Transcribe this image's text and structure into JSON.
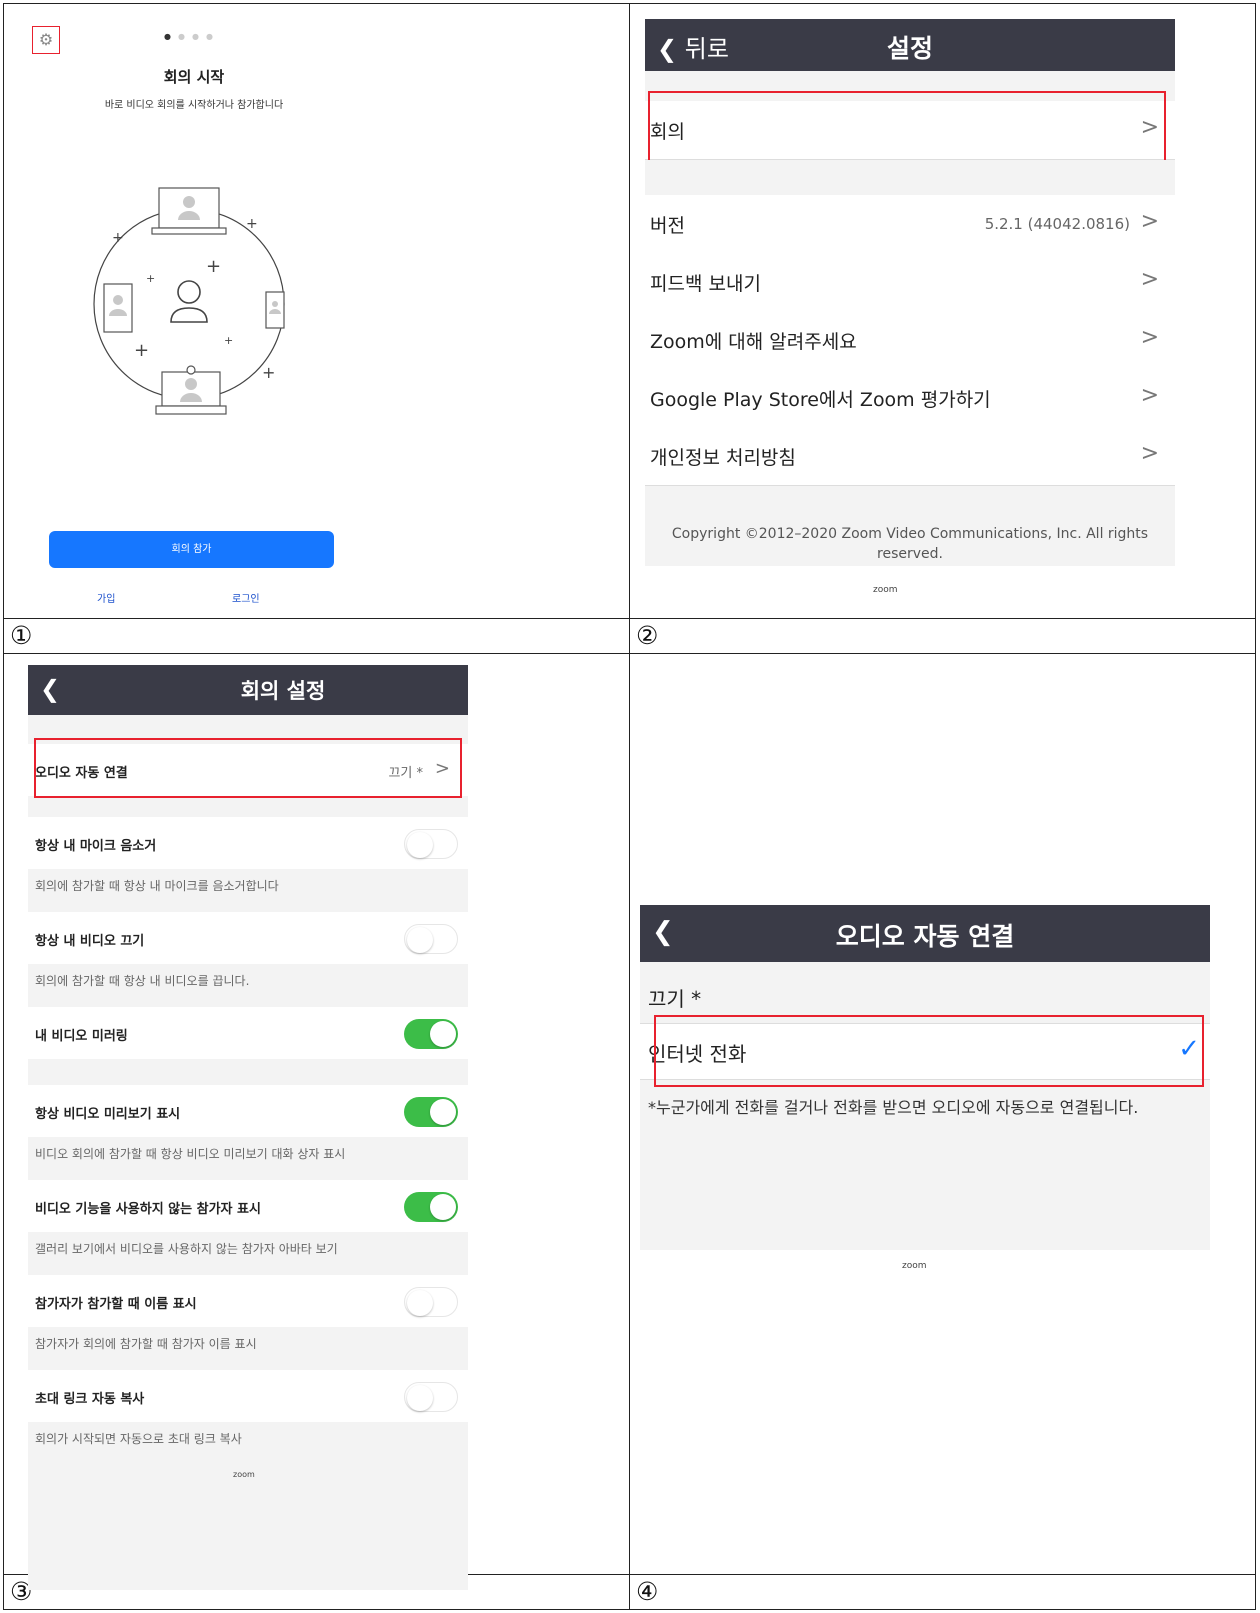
{
  "labels": [
    "①",
    "②",
    "③",
    "④"
  ],
  "colors": {
    "highlight": "#e8212e",
    "primary": "#1677ff",
    "header": "#3a3b47",
    "toggle_on": "#3cbd48"
  },
  "p1": {
    "title": "회의 시작",
    "subtitle": "바로 비디오 회의를 시작하거나 참가합니다",
    "join_button": "회의 참가",
    "signup": "가입",
    "login": "로그인",
    "icons": {
      "settings": "gear-icon",
      "illustration": "devices-network-illustration"
    }
  },
  "p2": {
    "back": "❮ 뒤로",
    "title": "설정",
    "meeting": "회의",
    "items": [
      {
        "label": "버전",
        "value": "5.2.1 (44042.0816)"
      },
      {
        "label": "피드백 보내기",
        "value": ""
      },
      {
        "label": "Zoom에 대해 알려주세요",
        "value": ""
      },
      {
        "label": "Google Play Store에서 Zoom 평가하기",
        "value": ""
      },
      {
        "label": "개인정보 처리방침",
        "value": ""
      }
    ],
    "copyright": "Copyright ©2012–2020 Zoom Video Communications, Inc. All rights reserved.",
    "footer": "zoom"
  },
  "p3": {
    "back": "❮",
    "title": "회의 설정",
    "auto_audio": {
      "label": "오디오 자동 연결",
      "value": "끄기 *"
    },
    "settings": [
      {
        "label": "항상 내 마이크 음소거",
        "desc": "회의에 참가할 때 항상 내 마이크를 음소거합니다",
        "on": false
      },
      {
        "label": "항상 내 비디오 끄기",
        "desc": "회의에 참가할 때 항상 내 비디오를 끕니다.",
        "on": false
      },
      {
        "label": "내 비디오 미러링",
        "desc": "",
        "on": true
      },
      {
        "label": "항상 비디오 미리보기 표시",
        "desc": "비디오 회의에 참가할 때 항상 비디오 미리보기 대화 상자 표시",
        "on": true
      },
      {
        "label": "비디오 기능을 사용하지 않는 참가자 표시",
        "desc": "갤러리 보기에서 비디오를 사용하지 않는 참가자 아바타 보기",
        "on": true
      },
      {
        "label": "참가자가 참가할 때 이름 표시",
        "desc": "참가자가 회의에 참가할 때 참가자 이름 표시",
        "on": false
      },
      {
        "label": "초대 링크 자동 복사",
        "desc": "회의가 시작되면 자동으로 초대 링크 복사",
        "on": false
      }
    ],
    "footer": "zoom"
  },
  "p4": {
    "back": "❮",
    "title": "오디오 자동 연결",
    "off_option": "끄기 *",
    "internet": "인터넷 전화",
    "note": "*누군가에게 전화를 걸거나 전화를 받으면 오디오에 자동으로 연결됩니다.",
    "footer": "zoom"
  }
}
